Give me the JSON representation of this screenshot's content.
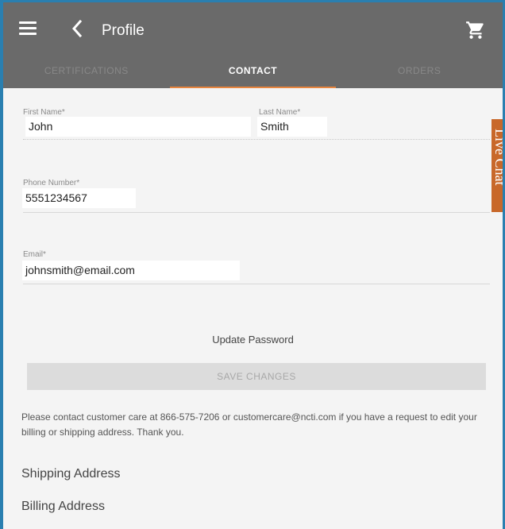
{
  "header": {
    "title": "Profile",
    "menu_icon": "hamburger-menu-icon",
    "back_icon": "chevron-left-icon",
    "cart_icon": "shopping-cart-icon"
  },
  "tabs": [
    {
      "label": "CERTIFICATIONS",
      "active": false
    },
    {
      "label": "CONTACT",
      "active": true
    },
    {
      "label": "ORDERS",
      "active": false
    }
  ],
  "form": {
    "first_name": {
      "label": "First Name",
      "required_mark": "*",
      "value": "John"
    },
    "last_name": {
      "label": "Last Name",
      "required_mark": "*",
      "value": "Smith"
    },
    "phone": {
      "label": "Phone Number",
      "required_mark": "*",
      "value": "5551234567"
    },
    "email": {
      "label": "Email",
      "required_mark": "*",
      "value": "johnsmith@email.com"
    },
    "update_password_label": "Update Password",
    "save_label": "SAVE CHANGES"
  },
  "notice": "Please contact customer care at 866-575-7206 or customercare@ncti.com if you have a request to edit your billing or shipping address. Thank you.",
  "sections": {
    "shipping": "Shipping Address",
    "billing": "Billing Address"
  },
  "live_chat_label": "Live Chat",
  "colors": {
    "header_bg": "#6a6a6a",
    "accent": "#e8853e",
    "frame_border": "#2a7fb0",
    "live_chat_bg": "#c8682a",
    "save_button_bg": "#dcdcdc"
  }
}
